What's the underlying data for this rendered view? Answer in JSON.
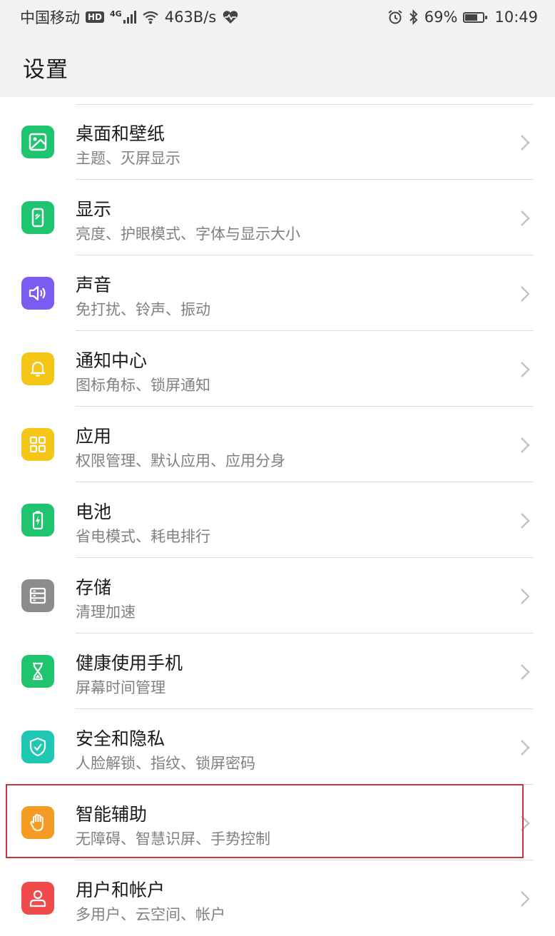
{
  "status_bar": {
    "carrier": "中国移动",
    "hd_badge": "HD",
    "network_type": "4G",
    "net_speed": "463B/s",
    "battery_percent": "69%",
    "battery_level": 0.69,
    "time": "10:49",
    "icons": [
      "signal-icon",
      "wifi-icon",
      "heart-icon",
      "alarm-icon",
      "bluetooth-icon",
      "battery-icon"
    ]
  },
  "header": {
    "title": "设置"
  },
  "settings": {
    "items": [
      {
        "title": "桌面和壁纸",
        "subtitle": "主题、灭屏显示",
        "icon": "wallpaper-icon",
        "color": "#1fc46f"
      },
      {
        "title": "显示",
        "subtitle": "亮度、护眼模式、字体与显示大小",
        "icon": "display-icon",
        "color": "#1fc46f"
      },
      {
        "title": "声音",
        "subtitle": "免打扰、铃声、振动",
        "icon": "speaker-icon",
        "color": "#7b5cf0"
      },
      {
        "title": "通知中心",
        "subtitle": "图标角标、锁屏通知",
        "icon": "bell-icon",
        "color": "#f5c518"
      },
      {
        "title": "应用",
        "subtitle": "权限管理、默认应用、应用分身",
        "icon": "apps-grid-icon",
        "color": "#f5c518"
      },
      {
        "title": "电池",
        "subtitle": "省电模式、耗电排行",
        "icon": "battery-bolt-icon",
        "color": "#1fc46f"
      },
      {
        "title": "存储",
        "subtitle": "清理加速",
        "icon": "storage-icon",
        "color": "#8c8c8c"
      },
      {
        "title": "健康使用手机",
        "subtitle": "屏幕时间管理",
        "icon": "hourglass-icon",
        "color": "#1fc46f"
      },
      {
        "title": "安全和隐私",
        "subtitle": "人脸解锁、指纹、锁屏密码",
        "icon": "shield-check-icon",
        "color": "#1ec8b4"
      },
      {
        "title": "智能辅助",
        "subtitle": "无障碍、智慧识屏、手势控制",
        "icon": "hand-icon",
        "color": "#f59a23"
      },
      {
        "title": "用户和帐户",
        "subtitle": "多用户、云空间、帐户",
        "icon": "user-icon",
        "color": "#ef4b4b"
      }
    ],
    "highlighted_item": "智能辅助",
    "highlight_color": "#c8373c"
  }
}
